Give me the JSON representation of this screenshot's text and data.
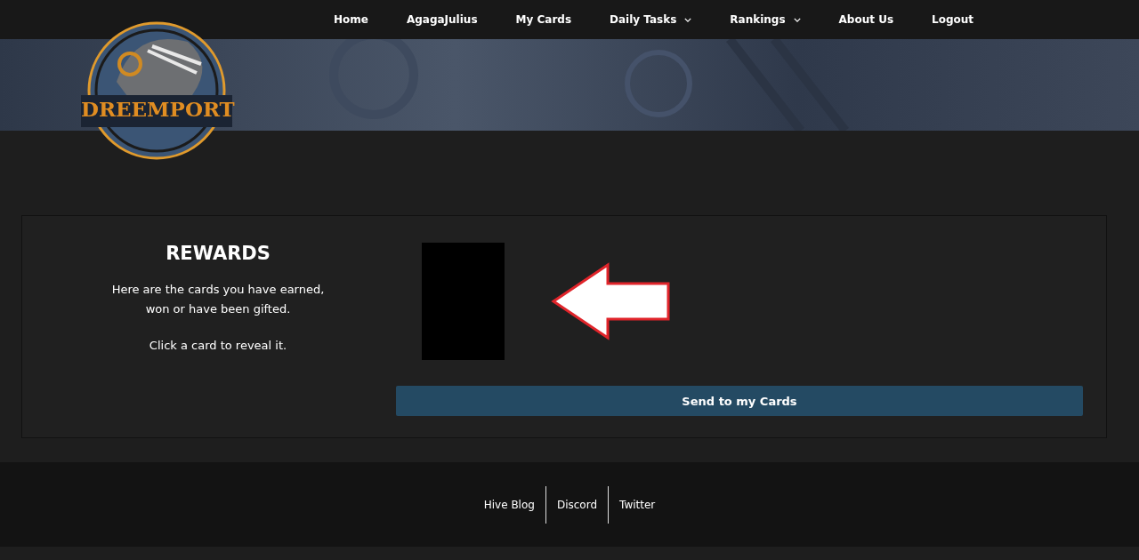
{
  "logo": {
    "text": "DREEMPORT"
  },
  "nav": [
    {
      "label": "Home",
      "kind": "link"
    },
    {
      "label": "AgagaJulius",
      "kind": "link"
    },
    {
      "label": "My Cards",
      "kind": "link"
    },
    {
      "label": "Daily Tasks",
      "kind": "dropdown"
    },
    {
      "label": "Rankings",
      "kind": "dropdown"
    },
    {
      "label": "About Us",
      "kind": "link"
    },
    {
      "label": "Logout",
      "kind": "link"
    }
  ],
  "rewards": {
    "title": "REWARDS",
    "description": [
      "Here are the cards you have earned,",
      "won or have been gifted."
    ],
    "hint": "Click a card to reveal it.",
    "cards": [
      {
        "revealed": false
      }
    ],
    "button": "Send to my Cards"
  },
  "footer": {
    "links": [
      "Hive Blog",
      "Discord",
      "Twitter"
    ]
  }
}
